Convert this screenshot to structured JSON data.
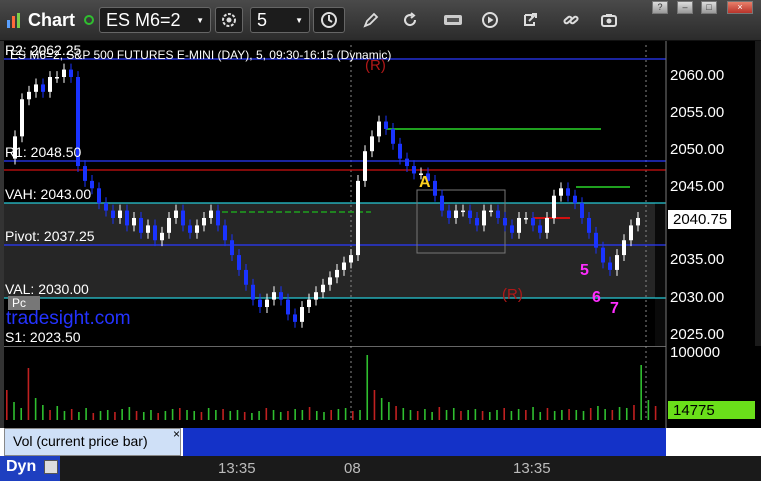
{
  "toolbar": {
    "app_title": "Chart",
    "symbol": "ES M6=2",
    "interval": "5",
    "window_controls": [
      "?",
      "–",
      "□",
      "×"
    ]
  },
  "chart": {
    "header": "ES M6=2, S&P 500 FUTURES E-MINI (DAY), 5, 09:30-16:15 (Dynamic)",
    "watermark": "tradesight.com",
    "levels": [
      {
        "label": "R2: 2062.25",
        "price": 2062.25
      },
      {
        "label": "R1: 2048.50",
        "price": 2048.5
      },
      {
        "label": "VAH: 2043.00",
        "price": 2043.0
      },
      {
        "label": "Pivot: 2037.25",
        "price": 2037.25
      },
      {
        "label": "VAL: 2030.00",
        "price": 2030.0
      },
      {
        "label": "S1: 2023.50",
        "price": 2023.5
      }
    ],
    "last_price": "2040.75",
    "last_volume": "14775",
    "y_ticks": [
      "2060.00",
      "2055.00",
      "2050.00",
      "2045.00",
      "2040.00",
      "2035.00",
      "2030.00",
      "2025.00"
    ],
    "vol_ticks": [
      "100000"
    ],
    "markers": {
      "A": "A",
      "R1": "(R)",
      "R2": "(R)",
      "pc": "Pc",
      "m5": "5",
      "m6": "6",
      "m7": "7"
    },
    "colors": {
      "up": "#ffffff",
      "down": "#1a33ff",
      "axis_bg": "#000000",
      "band": "#2a2a2a",
      "cyan": "#27c9d6",
      "green_line": "#1fa01f",
      "red": "#d01010"
    }
  },
  "bottom": {
    "tab_label": "Vol (current price bar)",
    "tab_close": "×",
    "dyn_label": "Dyn",
    "time_labels": [
      "13:35",
      "08",
      "13:35"
    ]
  }
}
